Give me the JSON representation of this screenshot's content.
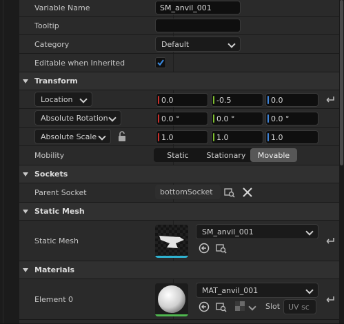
{
  "rows": {
    "variable_name": {
      "label": "Variable Name",
      "value": "SM_anvil_001"
    },
    "tooltip": {
      "label": "Tooltip",
      "value": ""
    },
    "category": {
      "label": "Category",
      "value": "Default"
    },
    "editable": {
      "label": "Editable when Inherited",
      "checked": true
    }
  },
  "transform": {
    "section": "Transform",
    "location": {
      "label": "Location",
      "x": "0.0",
      "y": "-0.5",
      "z": "0.0"
    },
    "rotation": {
      "label": "Absolute Rotation",
      "x": "0.0 °",
      "y": "0.0 °",
      "z": "0.0 °"
    },
    "scale": {
      "label": "Absolute Scale",
      "x": "1.0",
      "y": "1.0",
      "z": "1.0"
    },
    "mobility": {
      "label": "Mobility",
      "options": [
        "Static",
        "Stationary",
        "Movable"
      ],
      "selected": "Movable"
    }
  },
  "sockets": {
    "section": "Sockets",
    "parent_label": "Parent Socket",
    "parent_value": "bottomSocket"
  },
  "static_mesh": {
    "section": "Static Mesh",
    "label": "Static Mesh",
    "asset": "SM_anvil_001"
  },
  "materials": {
    "section": "Materials",
    "label": "Element 0",
    "asset": "MAT_anvil_001",
    "slot_label": "Slot",
    "slot_placeholder": "UV sc"
  },
  "colors": {
    "x_axis": "#c9302c",
    "y_axis": "#7fbf2f",
    "z_axis": "#3f84d8",
    "accent": "#2a6bd0",
    "mesh_underline": "#2fb3d1",
    "mat_underline": "#4fb84f"
  }
}
